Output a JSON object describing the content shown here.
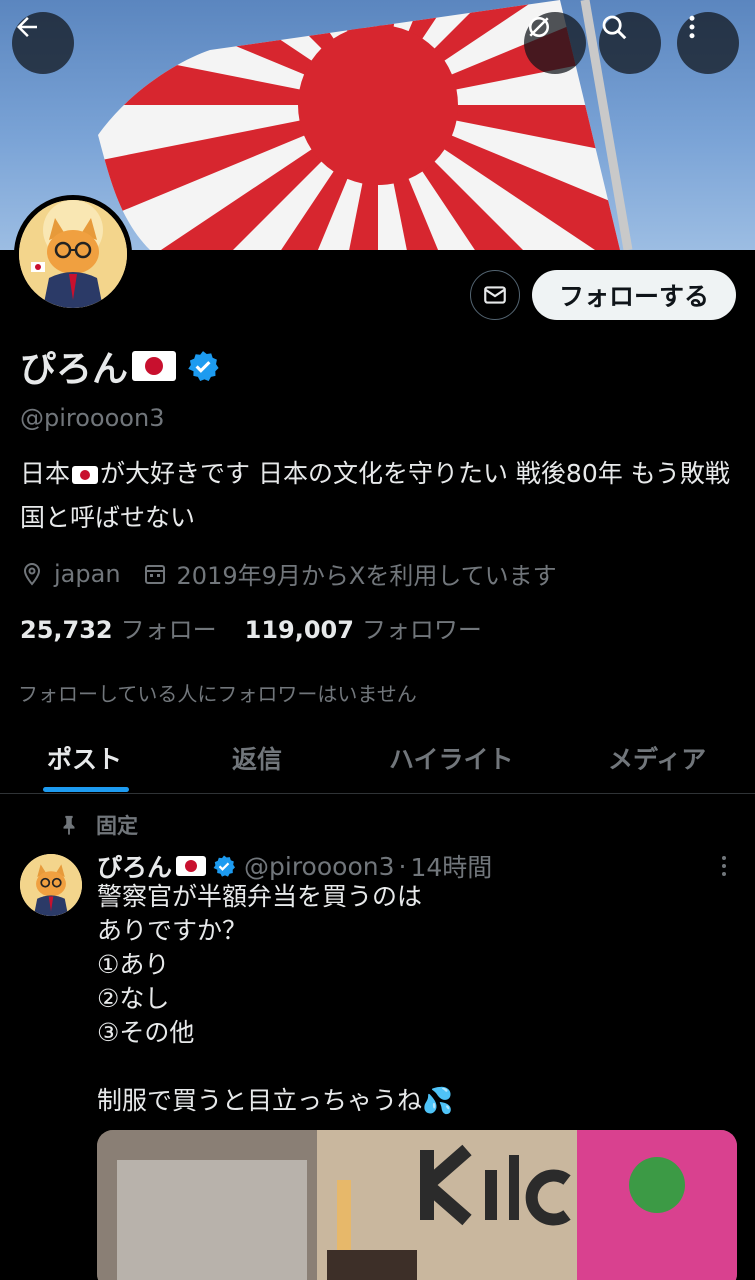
{
  "header": {
    "back_icon": "arrow-left-icon",
    "grok_icon": "grok-icon",
    "search_icon": "search-icon",
    "more_icon": "more-vertical-icon"
  },
  "profile": {
    "name": "ぴろん",
    "handle": "@piroooon3",
    "bio_before_flag": "日本",
    "bio_after_flag": "が大好きです 日本の文化を守りたい 戦後80年 もう敗戦国と呼ばせない",
    "location": "japan",
    "joined": "2019年9月からXを利用しています",
    "following_count": "25,732",
    "following_label": "フォロー",
    "followers_count": "119,007",
    "followers_label": "フォロワー",
    "no_mutual_followers": "フォローしている人にフォロワーはいません",
    "follow_button": "フォローする"
  },
  "tabs": [
    {
      "label": "ポスト"
    },
    {
      "label": "返信"
    },
    {
      "label": "ハイライト"
    },
    {
      "label": "メディア"
    }
  ],
  "post": {
    "pinned_label": "固定",
    "author_name": "ぴろん",
    "author_handle": "@piroooon3",
    "separator": "·",
    "time": "14時間",
    "text_lines": "警察官が半額弁当を買うのは\nありですか？\n①あり\n②なし\n③その他\n\n制服で買うと目立っちゃうね💦"
  },
  "colors": {
    "background": "#000000",
    "text_primary": "#e7e9ea",
    "text_secondary": "#71767b",
    "accent": "#1d9bf0",
    "border": "#2f3336"
  }
}
